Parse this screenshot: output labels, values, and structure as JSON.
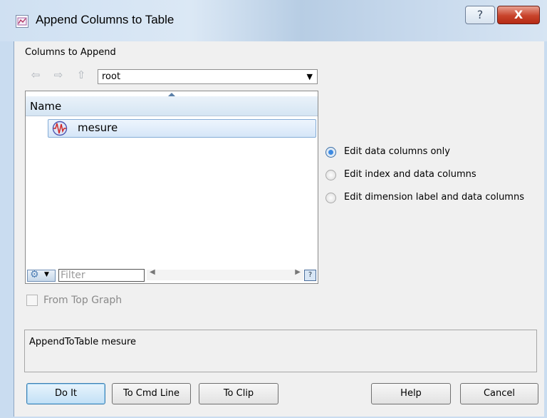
{
  "window": {
    "title": "Append Columns to Table",
    "help_glyph": "?",
    "close_glyph": "X"
  },
  "columns_section": {
    "label": "Columns to Append",
    "location_value": "root",
    "column_header": "Name",
    "items": [
      {
        "name": "mesure",
        "icon": "wave-icon",
        "selected": true
      }
    ],
    "filter_placeholder": "Filter"
  },
  "from_top_graph": {
    "label": "From Top Graph",
    "checked": false,
    "enabled": false
  },
  "edit_mode": {
    "options": [
      {
        "label": "Edit data columns only",
        "selected": true
      },
      {
        "label": "Edit index and data columns",
        "selected": false
      },
      {
        "label": "Edit dimension label and data columns",
        "selected": false
      }
    ]
  },
  "command_text": "AppendToTable mesure",
  "buttons": {
    "do_it": "Do It",
    "to_cmd_line": "To Cmd Line",
    "to_clip": "To Clip",
    "help": "Help",
    "cancel": "Cancel"
  },
  "colors": {
    "selection": "#d6e6f8",
    "selection_border": "#84acd6",
    "close_button": "#c8432b"
  }
}
